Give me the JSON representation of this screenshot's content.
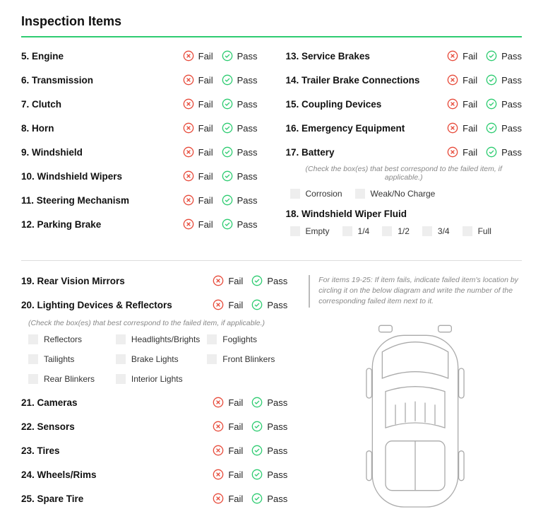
{
  "title": "Inspection Items",
  "fail_label": "Fail",
  "pass_label": "Pass",
  "left_items": [
    {
      "num": "5",
      "name": "Engine"
    },
    {
      "num": "6",
      "name": "Transmission"
    },
    {
      "num": "7",
      "name": "Clutch"
    },
    {
      "num": "8",
      "name": "Horn"
    },
    {
      "num": "9",
      "name": "Windshield"
    },
    {
      "num": "10",
      "name": "Windshield Wipers"
    },
    {
      "num": "11",
      "name": "Steering Mechanism"
    },
    {
      "num": "12",
      "name": "Parking Brake"
    }
  ],
  "right_items_a": [
    {
      "num": "13",
      "name": "Service Brakes"
    },
    {
      "num": "14",
      "name": "Trailer Brake Connections"
    },
    {
      "num": "15",
      "name": "Coupling Devices"
    },
    {
      "num": "16",
      "name": "Emergency Equipment"
    },
    {
      "num": "17",
      "name": "Battery"
    }
  ],
  "battery_note": "(Check the box(es) that best correspond to the failed item, if applicable.)",
  "battery_options": [
    "Corrosion",
    "Weak/No Charge"
  ],
  "fluid_label": {
    "num": "18",
    "name": "Windshield Wiper Fluid"
  },
  "fluid_options": [
    "Empty",
    "1/4",
    "1/2",
    "3/4",
    "Full"
  ],
  "mid_items": [
    {
      "num": "19",
      "name": "Rear Vision Mirrors"
    },
    {
      "num": "20",
      "name": "Lighting Devices & Reflectors"
    }
  ],
  "lighting_note": "(Check the box(es) that best correspond to the failed item, if applicable.)",
  "lighting_options": [
    "Reflectors",
    "Headlights/Brights",
    "Foglights",
    "Tailights",
    "Brake Lights",
    "Front Blinkers",
    "Rear Blinkers",
    "Interior Lights"
  ],
  "lower_items": [
    {
      "num": "21",
      "name": "Cameras"
    },
    {
      "num": "22",
      "name": "Sensors"
    },
    {
      "num": "23",
      "name": "Tires"
    },
    {
      "num": "24",
      "name": "Wheels/Rims"
    },
    {
      "num": "25",
      "name": "Spare Tire"
    }
  ],
  "diagram_note": "For items 19-25: If item fails, indicate failed item's location by circling it on the below diagram and write the number of the corresponding failed item next to it."
}
